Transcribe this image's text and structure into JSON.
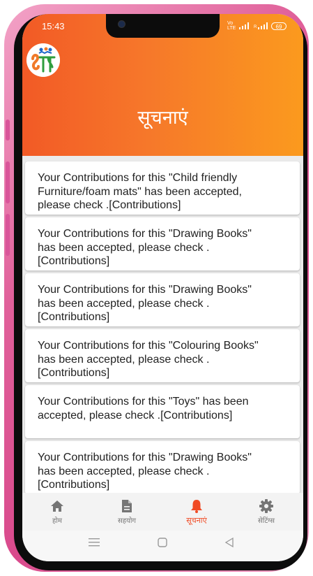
{
  "status_bar": {
    "time": "15:43",
    "network_label": "Vo LTE",
    "battery": "69"
  },
  "header": {
    "logo_icon": "sang-logo",
    "title": "सूचनाएं"
  },
  "notifications": [
    {
      "text": "Your Contributions for this \"Child friendly Furniture/foam mats\"  has been accepted, please check  .[Contributions]"
    },
    {
      "text": "Your Contributions for this \"Drawing Books\"  has been accepted, please check  .[Contributions]"
    },
    {
      "text": "Your Contributions for this \"Drawing Books\"  has been accepted, please check  .[Contributions]"
    },
    {
      "text": "Your Contributions for this \"Colouring Books\"  has been accepted, please check  .[Contributions]"
    },
    {
      "text": "Your Contributions for this \"Toys\"  has been accepted, please check  .[Contributions]"
    },
    {
      "text": "Your Contributions for this \"Drawing Books\"  has been accepted, please check  .[Contributions]"
    }
  ],
  "bottom_nav": {
    "items": [
      {
        "label": "होम",
        "icon": "home-icon"
      },
      {
        "label": "सहयोग",
        "icon": "document-icon"
      },
      {
        "label": "सूचनाएं",
        "icon": "bell-icon",
        "active": true
      },
      {
        "label": "सेटिंग्स",
        "icon": "gear-icon"
      }
    ]
  },
  "colors": {
    "header_start": "#f25a26",
    "header_end": "#fb9a1e",
    "accent": "#f04a24",
    "phone_frame": "#d94a8c"
  }
}
